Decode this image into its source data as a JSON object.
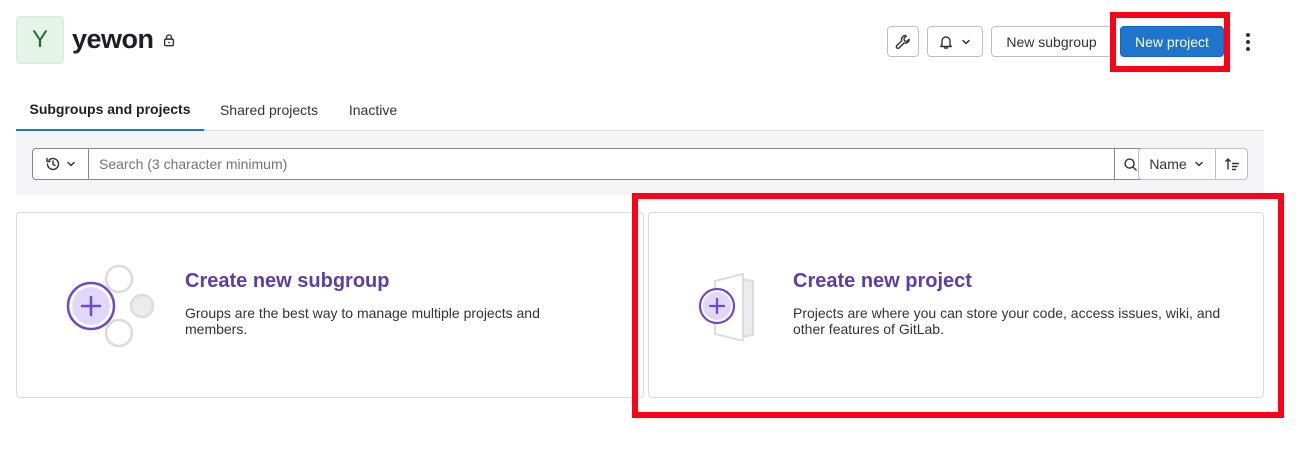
{
  "group": {
    "avatar_letter": "Y",
    "name": "yewon"
  },
  "header": {
    "new_subgroup_label": "New subgroup",
    "new_project_label": "New project"
  },
  "tabs": [
    {
      "label": "Subgroups and projects",
      "active": true
    },
    {
      "label": "Shared projects",
      "active": false
    },
    {
      "label": "Inactive",
      "active": false
    }
  ],
  "filter": {
    "search_placeholder": "Search (3 character minimum)",
    "sort_label": "Name"
  },
  "cards": {
    "subgroup": {
      "title": "Create new subgroup",
      "description": "Groups are the best way to manage multiple projects and members."
    },
    "project": {
      "title": "Create new project",
      "description": "Projects are where you can store your code, access issues, wiki, and other features of GitLab."
    }
  },
  "colors": {
    "primary": "#1f75cb",
    "card_title": "#5a3fac",
    "highlight": "#ff0018",
    "avatar_bg": "#e3f5e6"
  },
  "icons": [
    "lock-icon",
    "wrench-icon",
    "bell-icon",
    "chevron-down-icon",
    "kebab-icon",
    "history-icon",
    "search-icon",
    "sort-direction-icon",
    "subgroup-illustration-icon",
    "project-illustration-icon"
  ]
}
